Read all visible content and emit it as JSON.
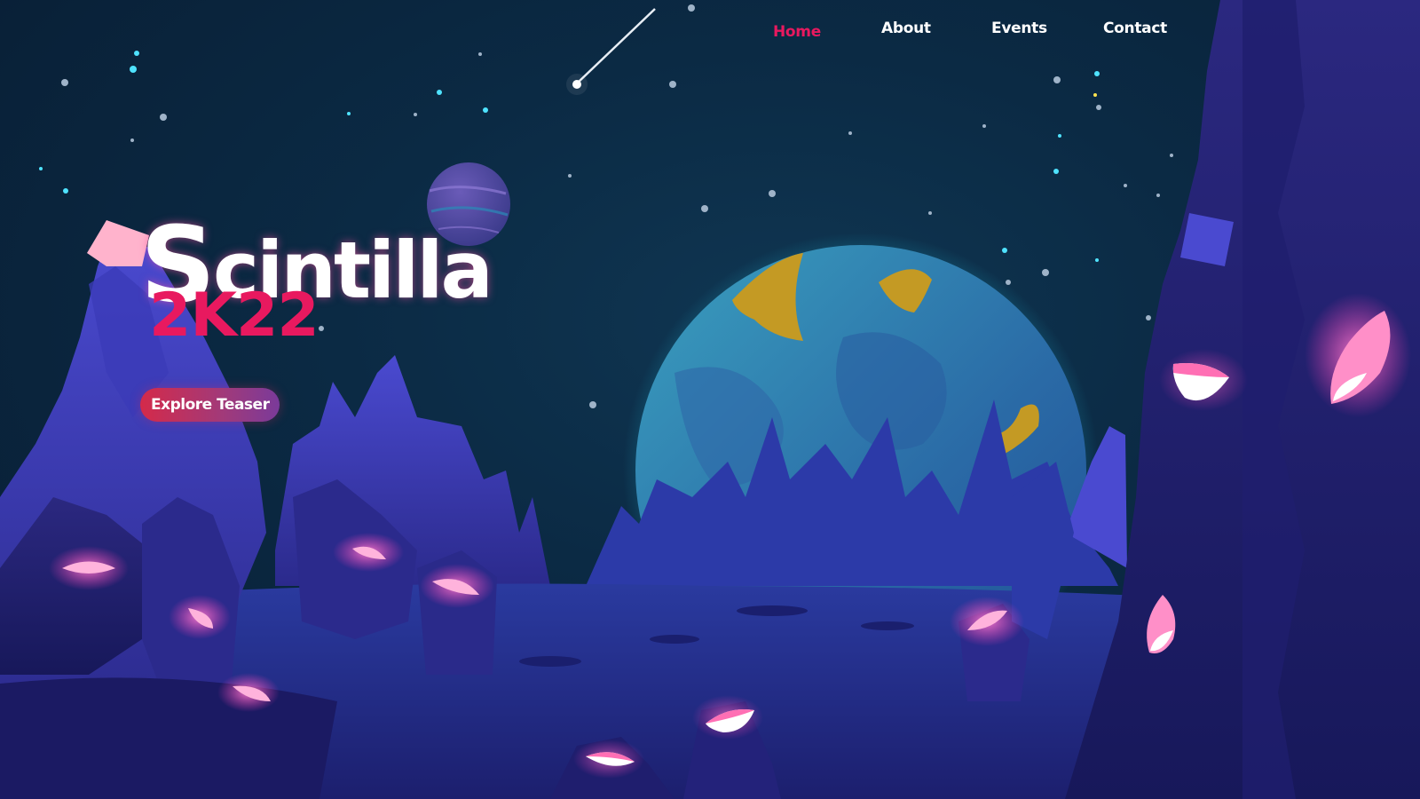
{
  "nav": {
    "items": [
      {
        "label": "Home",
        "active": true
      },
      {
        "label": "About",
        "active": false
      },
      {
        "label": "Events",
        "active": false
      },
      {
        "label": "Contact",
        "active": false
      }
    ]
  },
  "hero": {
    "title_first": "S",
    "title_rest": "cintilla",
    "subtitle": "2K22",
    "cta_label": "Explore Teaser"
  },
  "colors": {
    "accent": "#e8195f",
    "sky": "#0b2a44",
    "rock": "#2a2a8f",
    "crystal": "#ff6fb4",
    "planet": "#2f7aa8",
    "planet_land": "#c49a24"
  },
  "icons": [
    "shooting-star-icon",
    "planet-icon"
  ]
}
